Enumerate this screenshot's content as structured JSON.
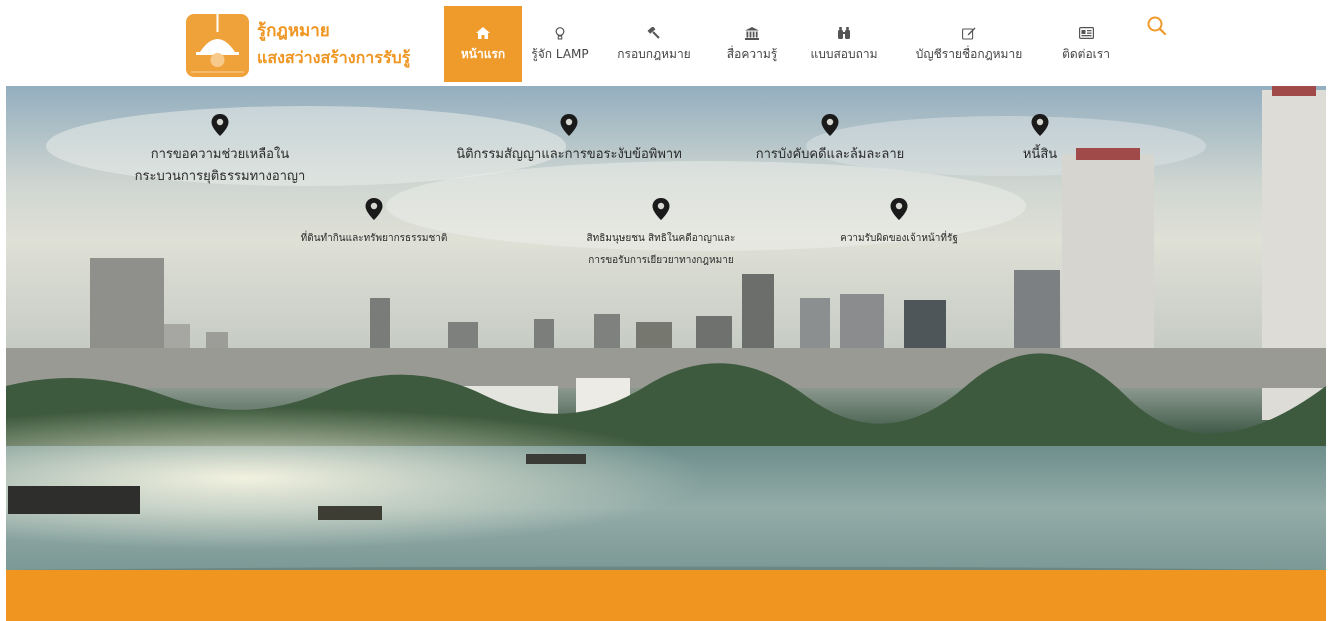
{
  "logo": {
    "line1": "รู้กฎหมาย",
    "line2": "แสงสว่างสร้างการรับรู้"
  },
  "nav": [
    {
      "label": "หน้าแรก",
      "icon": "home-icon",
      "active": true
    },
    {
      "label": "รู้จัก LAMP",
      "icon": "bulb-icon",
      "active": false
    },
    {
      "label": "กรอบกฎหมาย",
      "icon": "gavel-icon",
      "active": false
    },
    {
      "label": "สื่อความรู้",
      "icon": "institution-icon",
      "active": false
    },
    {
      "label": "แบบสอบถาม",
      "icon": "binoculars-icon",
      "active": false
    },
    {
      "label": "บัญชีรายชื่อกฎหมาย",
      "icon": "edit-icon",
      "active": false
    },
    {
      "label": "ติดต่อเรา",
      "icon": "contact-card-icon",
      "active": false
    }
  ],
  "hero": {
    "topics": [
      {
        "line1": "การขอความช่วยเหลือใน",
        "line2": "กระบวนการยุติธรรมทางอาญา"
      },
      {
        "line1": "นิติกรรมสัญญาและการขอระงับข้อพิพาท",
        "line2": ""
      },
      {
        "line1": "การบังคับคดีและล้มละลาย",
        "line2": ""
      },
      {
        "line1": "หนี้สิน",
        "line2": ""
      },
      {
        "line1": "ที่ดินทำกินและทรัพยากรธรรมชาติ",
        "line2": ""
      },
      {
        "line1": "สิทธิมนุษยชน สิทธิในคดีอาญาและ",
        "line2": "การขอรับการเยียวยาทางกฎหมาย"
      },
      {
        "line1": "ความรับผิดของเจ้าหน้าที่รัฐ",
        "line2": ""
      }
    ]
  },
  "colors": {
    "accent": "#ef9520",
    "logo_bg": "#f0a23a",
    "nav_text": "#444444"
  }
}
